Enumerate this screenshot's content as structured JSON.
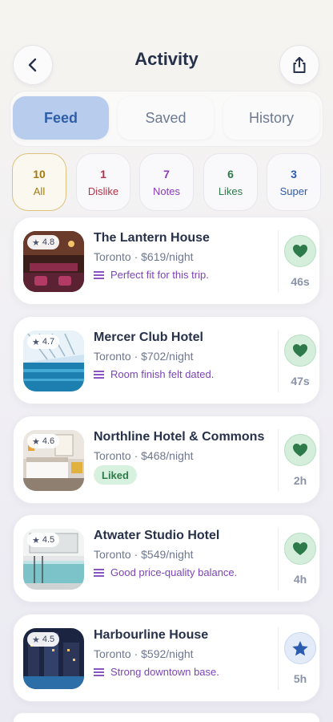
{
  "header": {
    "title": "Activity",
    "back_icon": "chevron-left-icon",
    "share_icon": "share-icon"
  },
  "tabs": [
    {
      "label": "Feed",
      "active": true
    },
    {
      "label": "Saved",
      "active": false
    },
    {
      "label": "History",
      "active": false
    }
  ],
  "filters": [
    {
      "count": "10",
      "label": "All",
      "active": true
    },
    {
      "count": "1",
      "label": "Dislike"
    },
    {
      "count": "7",
      "label": "Notes"
    },
    {
      "count": "6",
      "label": "Likes"
    },
    {
      "count": "3",
      "label": "Super"
    }
  ],
  "cards": [
    {
      "rating": "4.8",
      "name": "The Lantern House",
      "meta": "Toronto · $619/night",
      "note": "Perfect fit for this trip.",
      "reaction": "like",
      "time": "46s"
    },
    {
      "rating": "4.7",
      "name": "Mercer Club Hotel",
      "meta": "Toronto · $702/night",
      "note": "Room finish felt dated.",
      "reaction": "like",
      "time": "47s"
    },
    {
      "rating": "4.6",
      "name": "Northline Hotel & Commons",
      "meta": "Toronto · $468/night",
      "badge": "Liked",
      "reaction": "like",
      "time": "2h"
    },
    {
      "rating": "4.5",
      "name": "Atwater Studio Hotel",
      "meta": "Toronto · $549/night",
      "note": "Good price-quality balance.",
      "reaction": "like",
      "time": "4h"
    },
    {
      "rating": "4.5",
      "name": "Harbourline House",
      "meta": "Toronto · $592/night",
      "note": "Strong downtown base.",
      "reaction": "super",
      "time": "5h"
    }
  ],
  "colors": {
    "accent": "#b8cdee",
    "like": "#2e7a4a",
    "super": "#2c5cb0",
    "note": "#7b44b5"
  }
}
